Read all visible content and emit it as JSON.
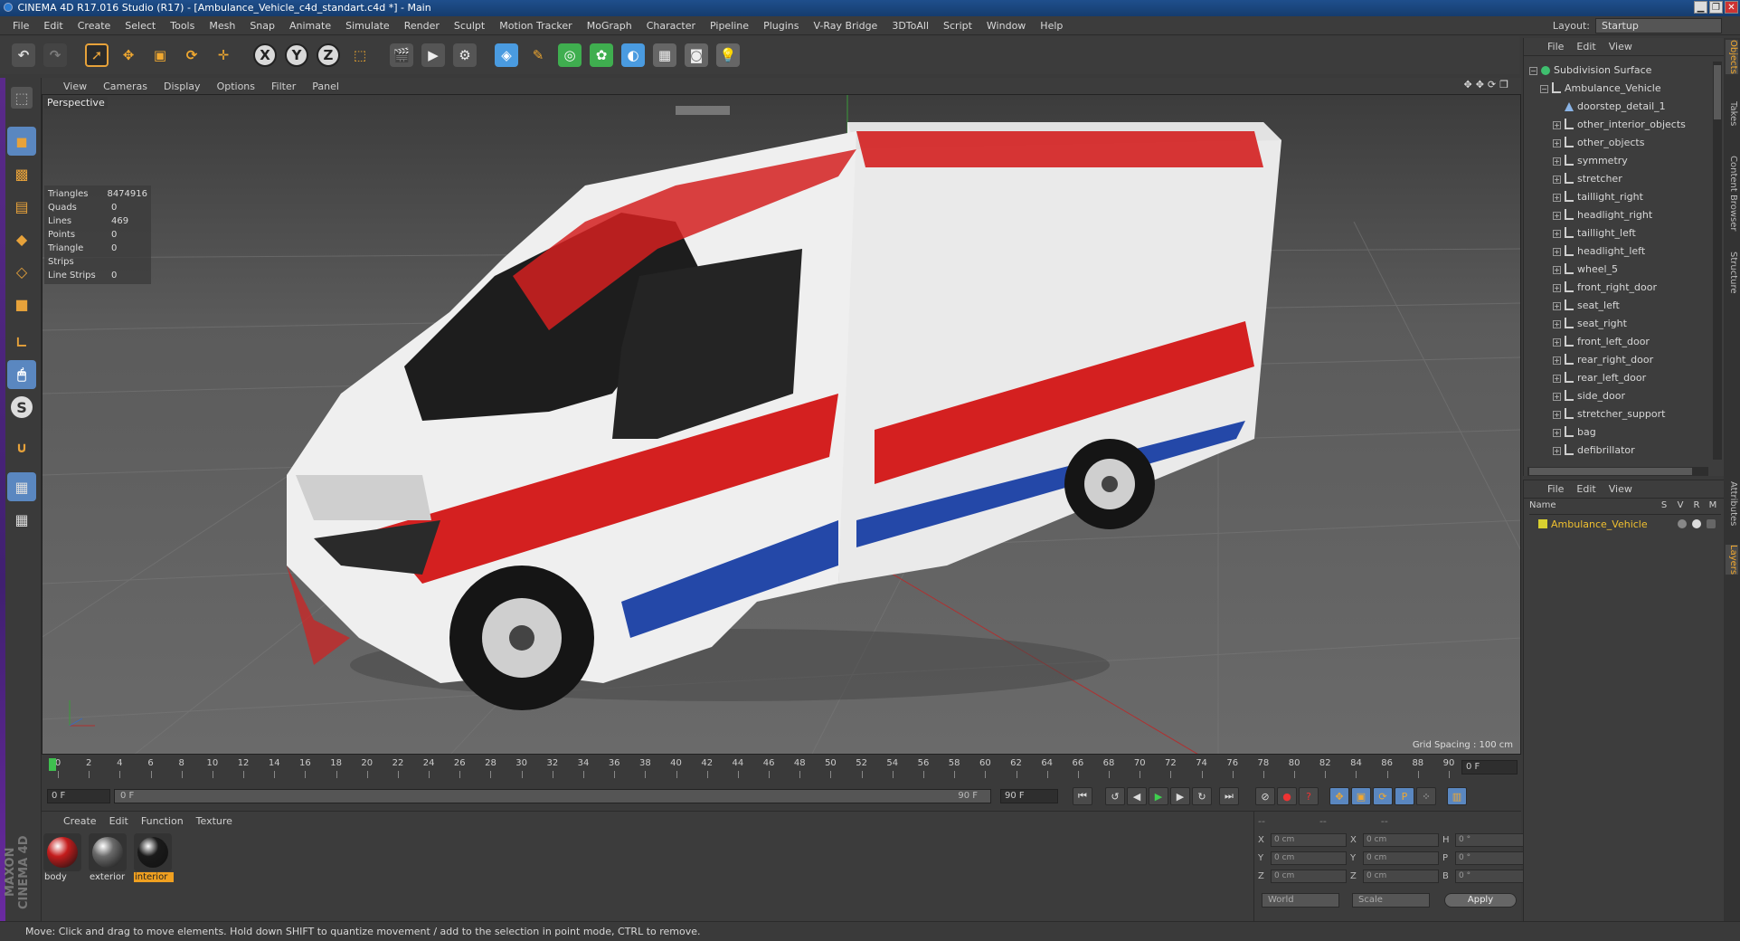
{
  "title": "CINEMA 4D R17.016 Studio (R17) - [Ambulance_Vehicle_c4d_standart.c4d *] - Main",
  "menu": [
    "File",
    "Edit",
    "Create",
    "Select",
    "Tools",
    "Mesh",
    "Snap",
    "Animate",
    "Simulate",
    "Render",
    "Sculpt",
    "Motion Tracker",
    "MoGraph",
    "Character",
    "Pipeline",
    "Plugins",
    "V-Ray Bridge",
    "3DToAll",
    "Script",
    "Window",
    "Help"
  ],
  "layout": {
    "label": "Layout:",
    "value": "Startup"
  },
  "viewport": {
    "menu": [
      "View",
      "Cameras",
      "Display",
      "Options",
      "Filter",
      "Panel"
    ],
    "camera": "Perspective",
    "stats": [
      {
        "k": "Triangles",
        "v": "8474916"
      },
      {
        "k": "Quads",
        "v": "0"
      },
      {
        "k": "Lines",
        "v": "469"
      },
      {
        "k": "Points",
        "v": "0"
      },
      {
        "k": "Triangle Strips",
        "v": "0"
      },
      {
        "k": "Line Strips",
        "v": "0"
      }
    ],
    "grid_spacing": "Grid Spacing : 100 cm"
  },
  "timeline": {
    "ticks": [
      "0",
      "2",
      "4",
      "6",
      "8",
      "10",
      "12",
      "14",
      "16",
      "18",
      "20",
      "22",
      "24",
      "26",
      "28",
      "30",
      "32",
      "34",
      "36",
      "38",
      "40",
      "42",
      "44",
      "46",
      "48",
      "50",
      "52",
      "54",
      "56",
      "58",
      "60",
      "62",
      "64",
      "66",
      "68",
      "70",
      "72",
      "74",
      "76",
      "78",
      "80",
      "82",
      "84",
      "86",
      "88",
      "90"
    ],
    "current_frame": "0 F"
  },
  "transport": {
    "start": "0 F",
    "slider_start": "0 F",
    "slider_end": "90 F",
    "end": "90 F"
  },
  "materials": {
    "menu": [
      "Create",
      "Edit",
      "Function",
      "Texture"
    ],
    "items": [
      {
        "name": "body",
        "color": "#c41d1d"
      },
      {
        "name": "exterior",
        "color": "#6a6a6a"
      },
      {
        "name": "interior",
        "color": "#1a1a1a"
      }
    ],
    "selected": "interior",
    "brand": "MAXON CINEMA 4D"
  },
  "coords": {
    "header": [
      "--",
      "--",
      "--"
    ],
    "rows": [
      {
        "a": "X",
        "av": "0 cm",
        "b": "X",
        "bv": "0 cm",
        "c": "H",
        "cv": "0 °"
      },
      {
        "a": "Y",
        "av": "0 cm",
        "b": "Y",
        "bv": "0 cm",
        "c": "P",
        "cv": "0 °"
      },
      {
        "a": "Z",
        "av": "0 cm",
        "b": "Z",
        "bv": "0 cm",
        "c": "B",
        "cv": "0 °"
      }
    ],
    "space": "World",
    "mode": "Scale",
    "apply": "Apply"
  },
  "object_manager": {
    "menu": [
      "File",
      "Edit",
      "View"
    ],
    "root": "Subdivision Surface",
    "group": "Ambulance_Vehicle",
    "children": [
      "doorstep_detail_1",
      "other_interior_objects",
      "other_objects",
      "symmetry",
      "stretcher",
      "taillight_right",
      "headlight_right",
      "taillight_left",
      "headlight_left",
      "wheel_5",
      "front_right_door",
      "seat_left",
      "seat_right",
      "front_left_door",
      "rear_right_door",
      "rear_left_door",
      "side_door",
      "stretcher_support",
      "bag",
      "defibrillator"
    ]
  },
  "layer_manager": {
    "menu": [
      "File",
      "Edit",
      "View"
    ],
    "columns": [
      "Name",
      "S",
      "V",
      "R",
      "M"
    ],
    "layer": "Ambulance_Vehicle"
  },
  "right_tabs": [
    "Objects",
    "Takes",
    "Content Browser",
    "Structure",
    "Attributes",
    "Layers"
  ],
  "status": "Move: Click and drag to move elements. Hold down SHIFT to quantize movement / add to the selection in point mode, CTRL to remove."
}
